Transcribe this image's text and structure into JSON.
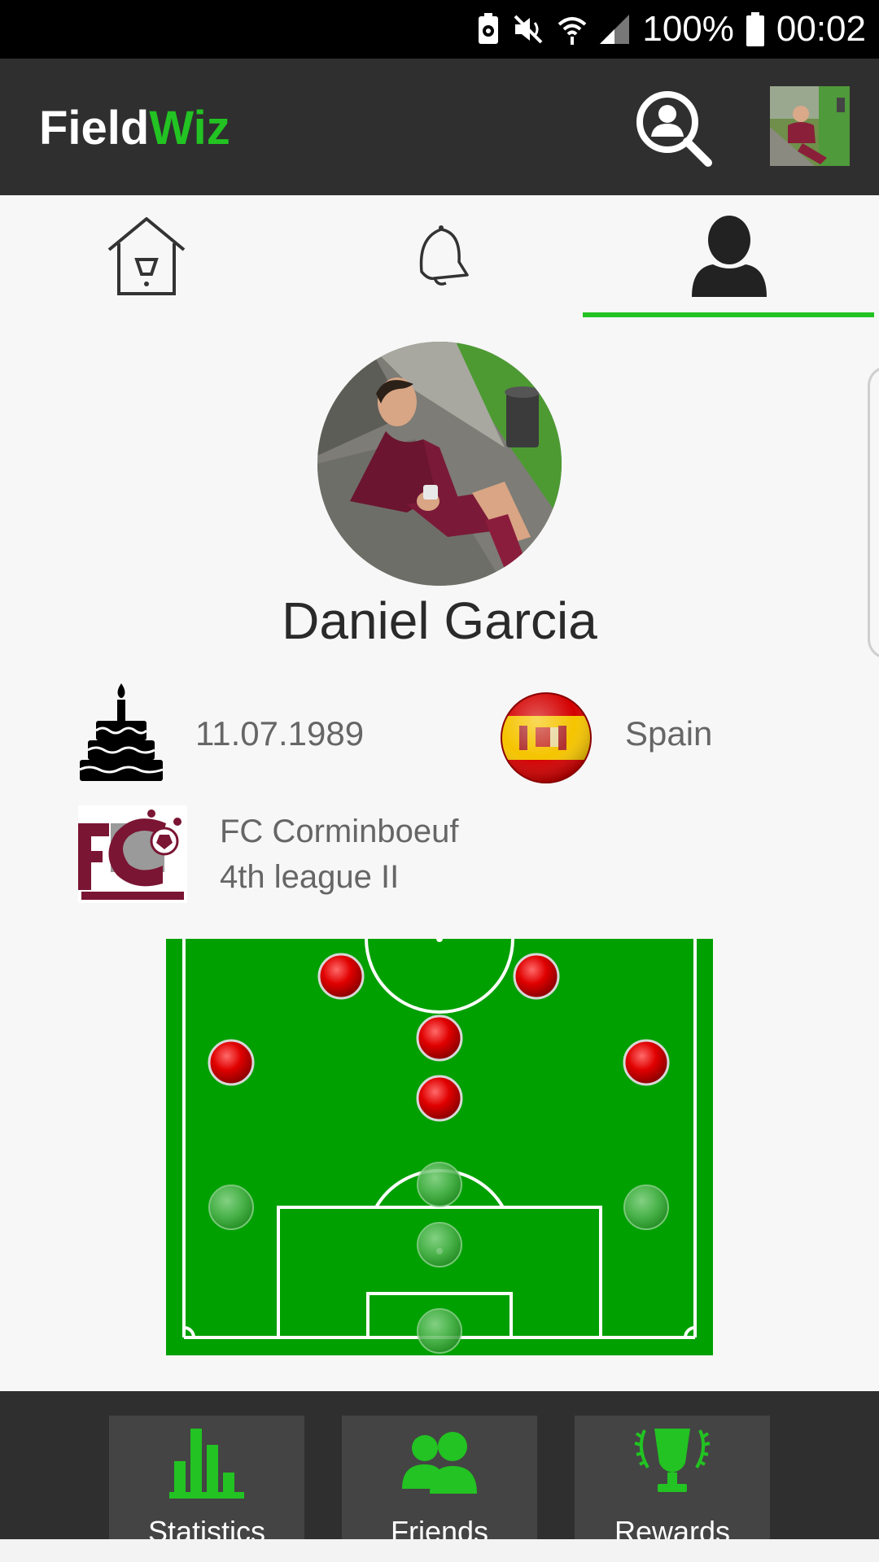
{
  "status_bar": {
    "battery": "100%",
    "time": "00:02"
  },
  "app_bar": {
    "brand_part1": "Field",
    "brand_part2": "Wiz",
    "brand_color": "#22c322"
  },
  "tabs": [
    {
      "name": "home",
      "icon": "house-icon"
    },
    {
      "name": "notifications",
      "icon": "bell-icon"
    },
    {
      "name": "profile",
      "icon": "person-icon",
      "selected": true
    }
  ],
  "profile": {
    "name": "Daniel Garcia",
    "birthdate": "11.07.1989",
    "country": "Spain",
    "club_name": "FC Corminboeuf",
    "club_league": "4th league II"
  },
  "field": {
    "background": "#00a000",
    "active_color": "#e60000"
  },
  "bottom_nav": [
    {
      "label": "Statistics",
      "icon": "bar-chart-icon"
    },
    {
      "label": "Friends",
      "icon": "friends-icon"
    },
    {
      "label": "Rewards",
      "icon": "trophy-icon"
    }
  ]
}
